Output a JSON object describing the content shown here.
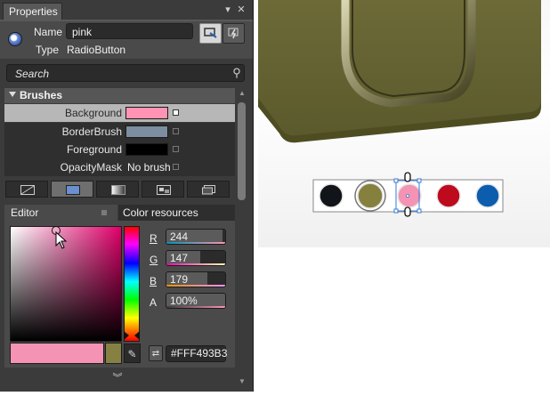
{
  "panel": {
    "tab_title": "Properties",
    "name_label": "Name",
    "name_value": "pink",
    "type_label": "Type",
    "type_value": "RadioButton",
    "pin_icon": "pin-icon",
    "close_icon": "close-icon"
  },
  "search": {
    "placeholder": "Search"
  },
  "brushes": {
    "category": "Brushes",
    "rows": [
      {
        "label": "Background",
        "value_text": "",
        "color": "#FF93B3"
      },
      {
        "label": "BorderBrush",
        "value_text": "",
        "color": "#7D8EA0"
      },
      {
        "label": "Foreground",
        "value_text": "",
        "color": "#000000"
      },
      {
        "label": "OpacityMask",
        "value_text": "No brush",
        "color": ""
      }
    ]
  },
  "editor": {
    "editor_tab": "Editor",
    "color_resources_tab": "Color resources",
    "r_label": "R",
    "r_value": "244",
    "g_label": "G",
    "g_value": "147",
    "b_label": "B",
    "b_value": "179",
    "a_label": "A",
    "a_value": "100%",
    "hex_value": "#FFF493B3",
    "r_level": 0.957,
    "g_level": 0.576,
    "b_level": 0.702,
    "a_level": 1.0,
    "new_color": "#F493B3",
    "old_color": "#878043"
  },
  "artboard": {
    "swatches": [
      "#111418",
      "#86803F",
      "#F493B3",
      "#BE0A1D",
      "#0C5DAE"
    ]
  }
}
